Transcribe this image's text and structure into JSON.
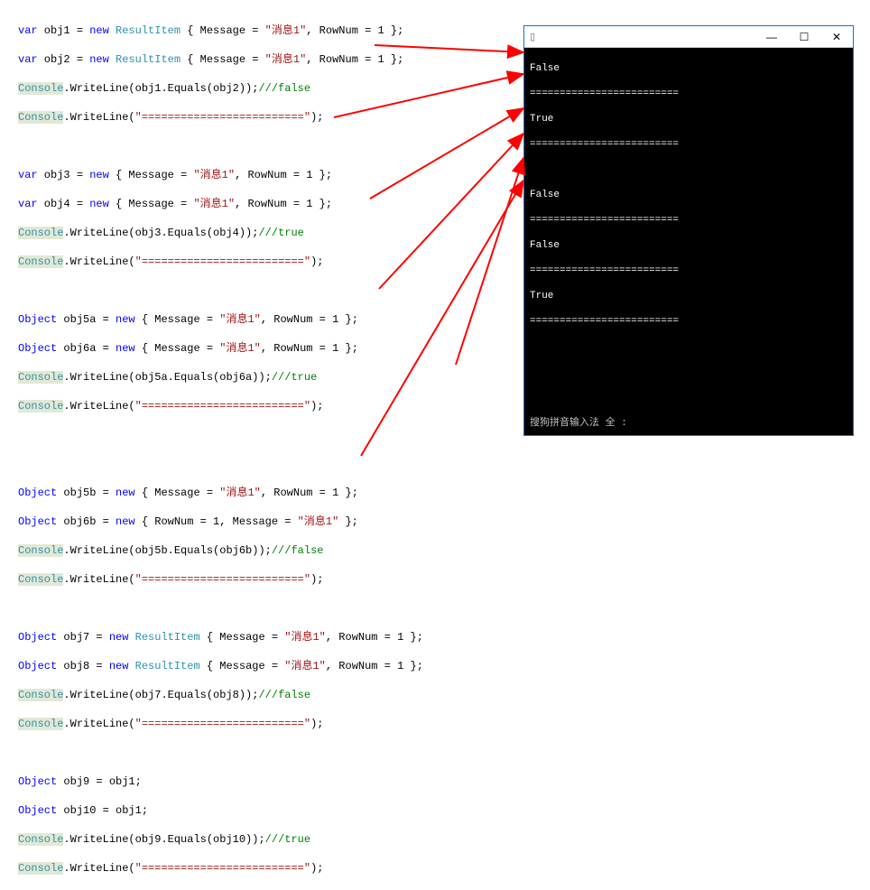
{
  "code": {
    "block1": {
      "l1_kw": "var",
      "l1_rest": " obj1 = ",
      "l1_new": "new",
      "l1_type": " ResultItem",
      "l1_body_a": " { Message = ",
      "l1_str": "\"消息1\"",
      "l1_body_b": ", RowNum = 1 };",
      "l2_kw": "var",
      "l2_rest": " obj2 = ",
      "l2_new": "new",
      "l2_type": " ResultItem",
      "l2_body_a": " { Message = ",
      "l2_str": "\"消息1\"",
      "l2_body_b": ", RowNum = 1 };",
      "l3_cls": "Console",
      "l3_call": ".WriteLine(obj1.Equals(obj2));",
      "l3_cmt": "///false",
      "l4_cls": "Console",
      "l4_call": ".WriteLine(",
      "l4_str": "\"=========================\"",
      "l4_end": ");"
    },
    "block2": {
      "l1_kw": "var",
      "l1_rest": " obj3 = ",
      "l1_new": "new",
      "l1_body_a": " { Message = ",
      "l1_str": "\"消息1\"",
      "l1_body_b": ", RowNum = 1 };",
      "l2_kw": "var",
      "l2_rest": " obj4 = ",
      "l2_new": "new",
      "l2_body_a": " { Message = ",
      "l2_str": "\"消息1\"",
      "l2_body_b": ", RowNum = 1 };",
      "l3_cls": "Console",
      "l3_call": ".WriteLine(obj3.Equals(obj4));",
      "l3_cmt": "///true",
      "l4_cls": "Console",
      "l4_call": ".WriteLine(",
      "l4_str": "\"=========================\"",
      "l4_end": ");"
    },
    "block3": {
      "l1_kw": "Object",
      "l1_rest": " obj5a = ",
      "l1_new": "new",
      "l1_body_a": " { Message = ",
      "l1_str": "\"消息1\"",
      "l1_body_b": ", RowNum = 1 };",
      "l2_kw": "Object",
      "l2_rest": " obj6a = ",
      "l2_new": "new",
      "l2_body_a": " { Message = ",
      "l2_str": "\"消息1\"",
      "l2_body_b": ", RowNum = 1 };",
      "l3_cls": "Console",
      "l3_call": ".WriteLine(obj5a.Equals(obj6a));",
      "l3_cmt": "///true",
      "l4_cls": "Console",
      "l4_call": ".WriteLine(",
      "l4_str": "\"=========================\"",
      "l4_end": ");"
    },
    "block4": {
      "l1_kw": "Object",
      "l1_rest": " obj5b = ",
      "l1_new": "new",
      "l1_body_a": " { Message = ",
      "l1_str": "\"消息1\"",
      "l1_body_b": ", RowNum = 1 };",
      "l2_kw": "Object",
      "l2_rest": " obj6b = ",
      "l2_new": "new",
      "l2_body_a": " { RowNum = 1, Message = ",
      "l2_str": "\"消息1\"",
      "l2_body_b": " };",
      "l3_cls": "Console",
      "l3_call": ".WriteLine(obj5b.Equals(obj6b));",
      "l3_cmt": "///false",
      "l4_cls": "Console",
      "l4_call": ".WriteLine(",
      "l4_str": "\"=========================\"",
      "l4_end": ");"
    },
    "block5": {
      "l1_kw": "Object",
      "l1_rest": " obj7 = ",
      "l1_new": "new",
      "l1_type": " ResultItem",
      "l1_body_a": " { Message = ",
      "l1_str": "\"消息1\"",
      "l1_body_b": ", RowNum = 1 };",
      "l2_kw": "Object",
      "l2_rest": " obj8 = ",
      "l2_new": "new",
      "l2_type": " ResultItem",
      "l2_body_a": " { Message = ",
      "l2_str": "\"消息1\"",
      "l2_body_b": ", RowNum = 1 };",
      "l3_cls": "Console",
      "l3_call": ".WriteLine(obj7.Equals(obj8));",
      "l3_cmt": "///false",
      "l4_cls": "Console",
      "l4_call": ".WriteLine(",
      "l4_str": "\"=========================\"",
      "l4_end": ");"
    },
    "block6": {
      "l1_kw": "Object",
      "l1_rest": " obj9 = obj1;",
      "l2_kw": "Object",
      "l2_rest": " obj10 = obj1;",
      "l3_cls": "Console",
      "l3_call": ".WriteLine(obj9.Equals(obj10));",
      "l3_cmt": "///true",
      "l4_cls": "Console",
      "l4_call": ".WriteLine(",
      "l4_str": "\"=========================\"",
      "l4_end": ");"
    }
  },
  "console": {
    "title_icon": "▯",
    "titlebar_text": " ",
    "minimize": "—",
    "maximize": "☐",
    "close": "✕",
    "lines": {
      "o1": "False",
      "sep": "=========================",
      "o2": "True",
      "o3": "False",
      "o4": "False",
      "o5": "True"
    },
    "ime_status": "搜狗拼音输入法 全 :"
  },
  "arrows": {
    "color": "#ff0000",
    "stroke": 2
  }
}
